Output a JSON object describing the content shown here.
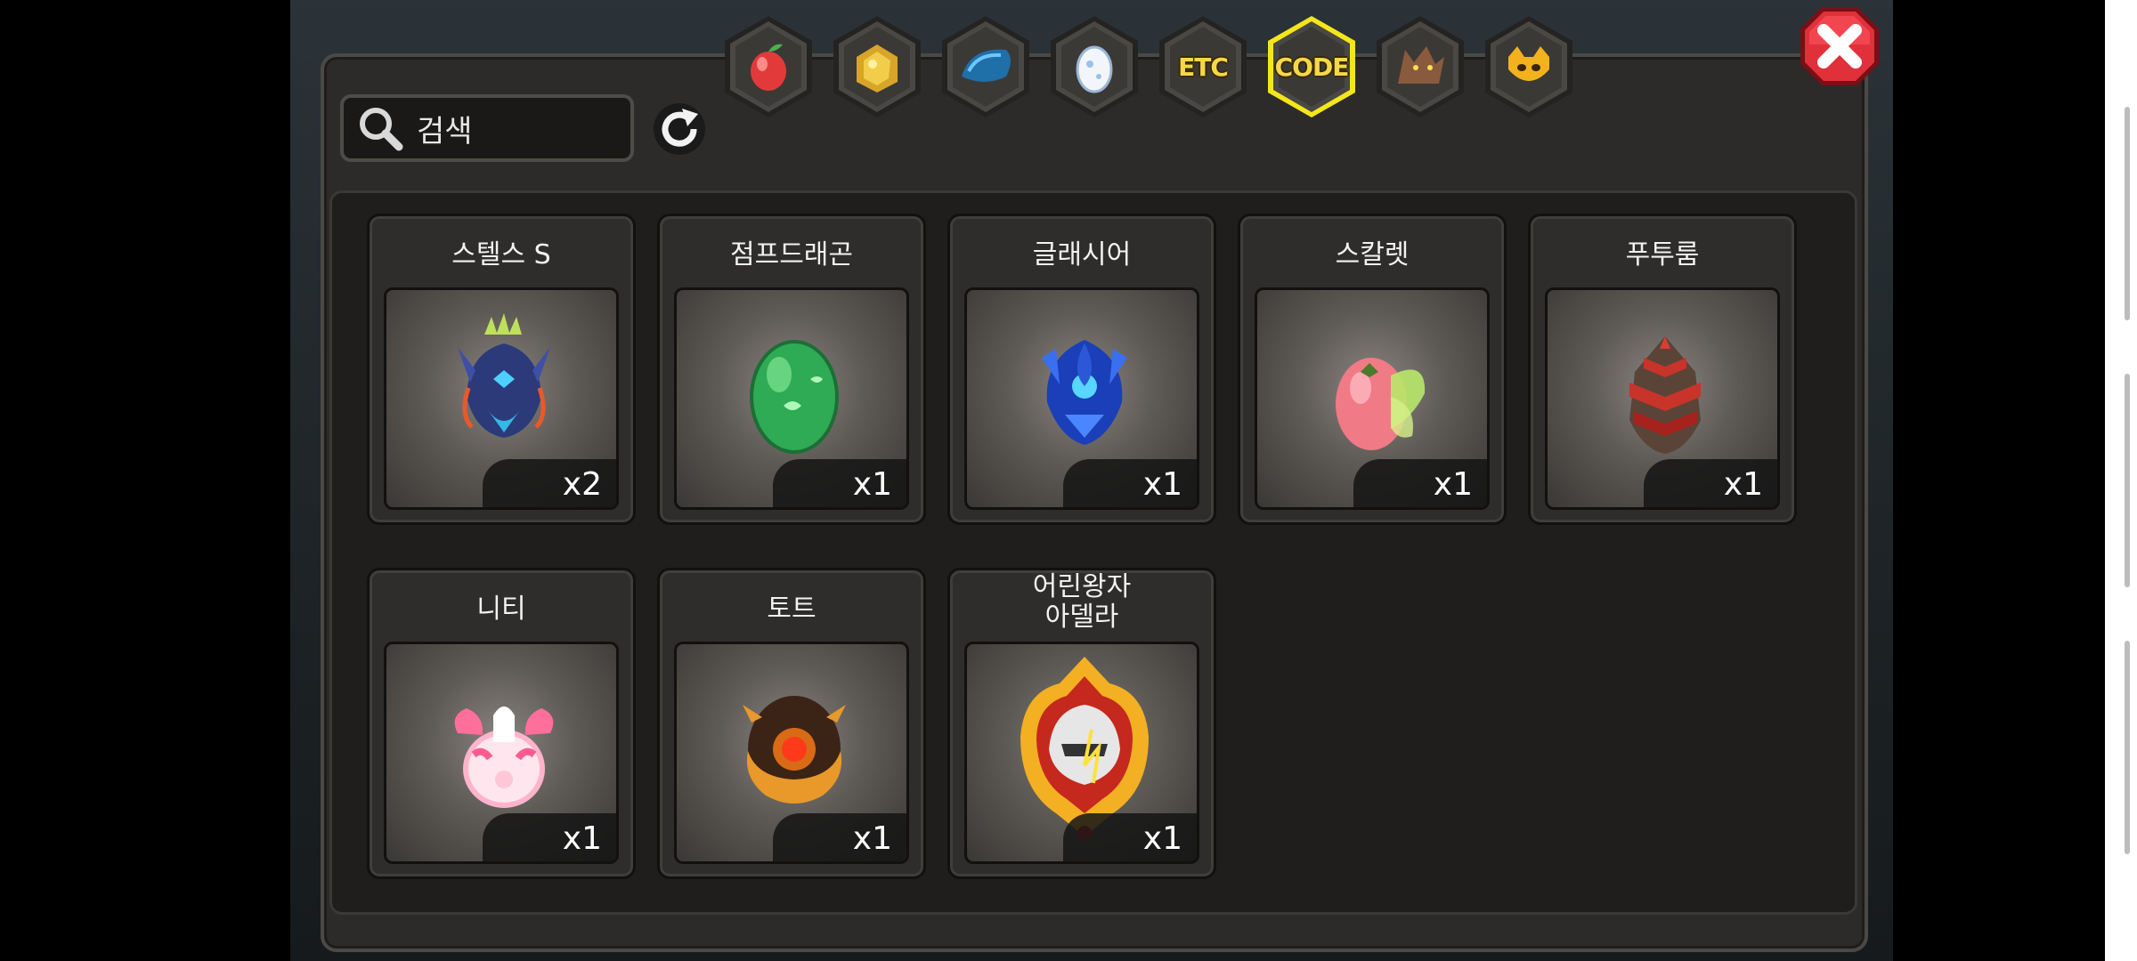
{
  "search": {
    "placeholder": "검색"
  },
  "tabs": [
    {
      "name": "fruit",
      "label": "",
      "active": false
    },
    {
      "name": "gold-ore",
      "label": "",
      "active": false
    },
    {
      "name": "dragon-scale",
      "label": "",
      "active": false
    },
    {
      "name": "egg",
      "label": "",
      "active": false
    },
    {
      "name": "etc",
      "label": "ETC",
      "active": false
    },
    {
      "name": "code",
      "label": "CODE",
      "active": true
    },
    {
      "name": "werewolf",
      "label": "",
      "active": false
    },
    {
      "name": "mask",
      "label": "",
      "active": false
    }
  ],
  "items": [
    {
      "name": "스텔스 S",
      "qty": "x2",
      "icon": "dark-blue-crest-egg-icon"
    },
    {
      "name": "점프드래곤",
      "qty": "x1",
      "icon": "green-egg-icon"
    },
    {
      "name": "글래시어",
      "qty": "x1",
      "icon": "blue-crystal-egg-icon"
    },
    {
      "name": "스칼렛",
      "qty": "x1",
      "icon": "pink-leaf-egg-icon"
    },
    {
      "name": "푸투룸",
      "qty": "x1",
      "icon": "red-armored-egg-icon"
    },
    {
      "name": "니티",
      "qty": "x1",
      "icon": "pink-ribbon-egg-icon"
    },
    {
      "name": "토트",
      "qty": "x1",
      "icon": "bronze-orb-egg-icon"
    },
    {
      "name": "어린왕자\n아델라",
      "qty": "x1",
      "icon": "golden-helm-crest-icon"
    }
  ],
  "colors": {
    "active_tab": "#f5e61a",
    "close": "#d21e2a",
    "qty_bg": "#141414"
  }
}
